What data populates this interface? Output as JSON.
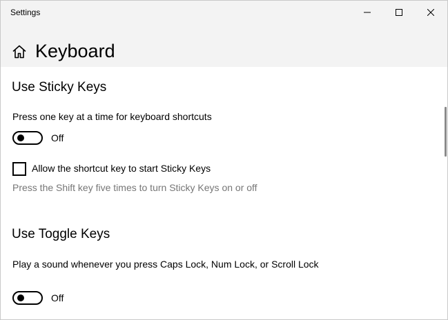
{
  "window": {
    "title": "Settings"
  },
  "header": {
    "page_title": "Keyboard"
  },
  "sticky_keys": {
    "section_title": "Use Sticky Keys",
    "description": "Press one key at a time for keyboard shortcuts",
    "toggle_state": "Off",
    "shortcut_checkbox_label": "Allow the shortcut key to start Sticky Keys",
    "shortcut_checked": false,
    "shortcut_hint": "Press the Shift key five times to turn Sticky Keys on or off"
  },
  "toggle_keys": {
    "section_title": "Use Toggle Keys",
    "description": "Play a sound whenever you press Caps Lock, Num Lock, or Scroll Lock",
    "toggle_state": "Off"
  },
  "icons": {
    "home": "home-icon",
    "minimize": "minimize-icon",
    "maximize": "maximize-icon",
    "close": "close-icon"
  },
  "colors": {
    "titlebar_bg": "#f3f3f3",
    "hint_text": "#767676",
    "content_bg": "#ffffff"
  }
}
